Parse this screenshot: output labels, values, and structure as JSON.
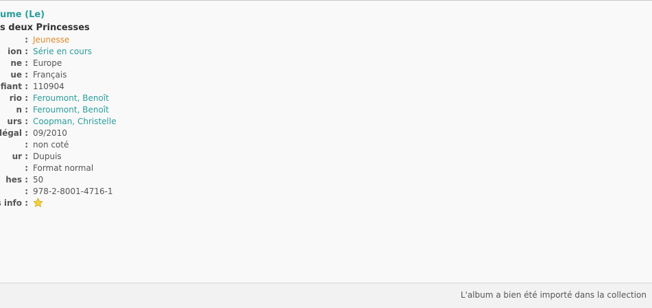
{
  "album": {
    "series_title": "ume (Le)",
    "title": "s deux Princesses"
  },
  "details": [
    {
      "label": ":",
      "value": "Jeunesse",
      "kind": "category"
    },
    {
      "label": "ion :",
      "value": "Série en cours",
      "kind": "link"
    },
    {
      "label": "ne :",
      "value": "Europe",
      "kind": "text"
    },
    {
      "label": "ue :",
      "value": "Français",
      "kind": "text"
    },
    {
      "label": "ifiant :",
      "value": "110904",
      "kind": "text"
    },
    {
      "label": "rio :",
      "value": "Feroumont, Benoît",
      "kind": "link"
    },
    {
      "label": "n :",
      "value": "Feroumont, Benoît",
      "kind": "link"
    },
    {
      "label": "urs :",
      "value": "Coopman, Christelle",
      "kind": "link"
    },
    {
      "label": "t légal :",
      "value": "09/2010",
      "kind": "text"
    },
    {
      "label": ":",
      "value": "non coté",
      "kind": "text"
    },
    {
      "label": "ur :",
      "value": "Dupuis",
      "kind": "text"
    },
    {
      "label": ":",
      "value": "Format normal",
      "kind": "text"
    },
    {
      "label": "hes :",
      "value": "50",
      "kind": "text"
    },
    {
      "label": ":",
      "value": "978-2-8001-4716-1",
      "kind": "text"
    },
    {
      "label": "s info :",
      "icon": "star-icon",
      "kind": "icon"
    }
  ],
  "status": {
    "message": "L'album a bien été importé dans la collection"
  },
  "colors": {
    "accent": "#2a9d9b",
    "category": "#e08a2c",
    "star": "#f5d33a"
  }
}
